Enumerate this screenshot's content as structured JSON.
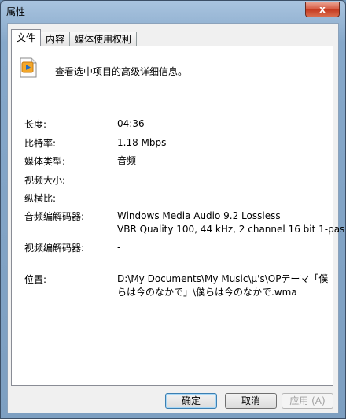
{
  "window": {
    "title": "属性",
    "close_label": "x"
  },
  "tabs": [
    {
      "label": "文件",
      "active": true
    },
    {
      "label": "内容",
      "active": false
    },
    {
      "label": "媒体使用权利",
      "active": false
    }
  ],
  "header": {
    "icon": "audio-file-icon",
    "text": "查看选中项目的高级详细信息。"
  },
  "properties": [
    {
      "label": "长度:",
      "value": "04:36"
    },
    {
      "label": "比特率:",
      "value": "1.18 Mbps"
    },
    {
      "label": "媒体类型:",
      "value": "音频"
    },
    {
      "label": "视频大小:",
      "value": "-"
    },
    {
      "label": "纵横比:",
      "value": "-"
    },
    {
      "label": "音频编解码器:",
      "value": "Windows Media Audio 9.2 Lossless",
      "value2": "VBR Quality 100, 44 kHz, 2 channel 16 bit 1-pas"
    },
    {
      "label": "视频编解码器:",
      "value": "-"
    },
    {
      "label": "位置:",
      "value": "D:\\My Documents\\My Music\\μ's\\OPテーマ「僕",
      "value2": "らは今のなかで」\\僕らは今のなかで.wma"
    }
  ],
  "buttons": {
    "ok": "确定",
    "cancel": "取消",
    "apply": "应用 (A)"
  }
}
